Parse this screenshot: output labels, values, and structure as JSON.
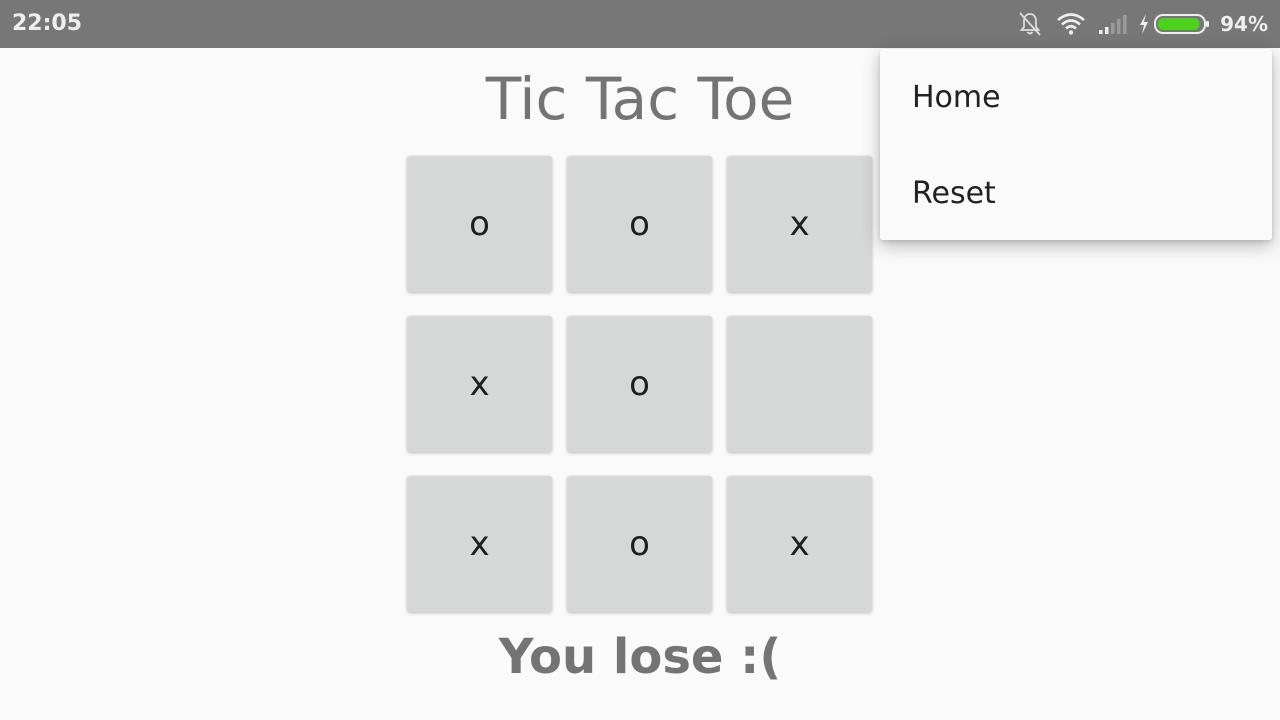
{
  "status_bar": {
    "time": "22:05",
    "battery_percent": "94%",
    "battery_level": 0.94,
    "icons": [
      "bell-off-icon",
      "wifi-icon",
      "signal-icon",
      "charging-icon",
      "battery-icon"
    ]
  },
  "title": "Tic Tac Toe",
  "board": {
    "cells": [
      [
        "o",
        "o",
        "x"
      ],
      [
        "x",
        "o",
        ""
      ],
      [
        "x",
        "o",
        "x"
      ]
    ]
  },
  "result": "You lose :(",
  "menu": {
    "items": [
      {
        "label": "Home"
      },
      {
        "label": "Reset"
      }
    ]
  },
  "colors": {
    "status_bar": "#777777",
    "cell": "#d6d7d7",
    "battery_fill": "#4cd11c",
    "title_text": "#747474"
  }
}
